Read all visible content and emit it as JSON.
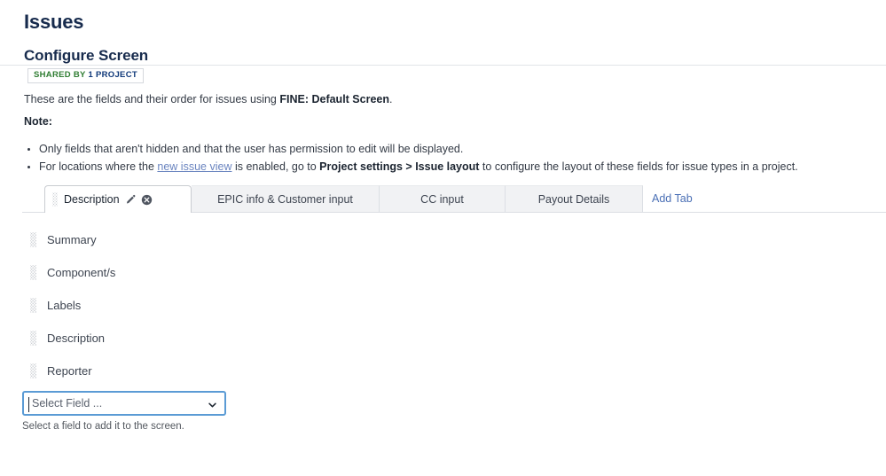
{
  "page": {
    "title": "Issues",
    "section_heading": "Configure Screen"
  },
  "shared_badge": {
    "prefix": "SHARED BY",
    "count": "1",
    "suffix": "PROJECT"
  },
  "intro": {
    "before": "These are the fields and their order for issues using ",
    "screen_name": "FINE: Default Screen",
    "after": "."
  },
  "note": {
    "label": "Note:",
    "items": [
      {
        "text": "Only fields that aren't hidden and that the user has permission to edit will be displayed."
      },
      {
        "before": "For locations where the ",
        "link": "new issue view",
        "middle": " is enabled, go to ",
        "bold": "Project settings > Issue layout",
        "after": " to configure the layout of these fields for issue types in a project."
      }
    ]
  },
  "tabs": {
    "items": [
      {
        "label": "Description",
        "active": true
      },
      {
        "label": "EPIC info & Customer input",
        "active": false
      },
      {
        "label": "CC input",
        "active": false
      },
      {
        "label": "Payout Details",
        "active": false
      }
    ],
    "add_tab_label": "Add Tab",
    "edit_icon": "pencil-icon",
    "remove_icon": "remove-circle-icon",
    "drag_icon": "drag-handle-icon"
  },
  "fields": [
    {
      "name": "Summary"
    },
    {
      "name": "Component/s"
    },
    {
      "name": "Labels"
    },
    {
      "name": "Description"
    },
    {
      "name": "Reporter"
    }
  ],
  "add_field": {
    "placeholder": "Select Field ...",
    "hint": "Select a field to add it to the screen.",
    "chevron_icon": "chevron-down-icon"
  },
  "colors": {
    "link": "#4a6fb5",
    "badge_green": "#2f7d32",
    "badge_blue": "#10397a",
    "focus_border": "#5b9bd5"
  }
}
